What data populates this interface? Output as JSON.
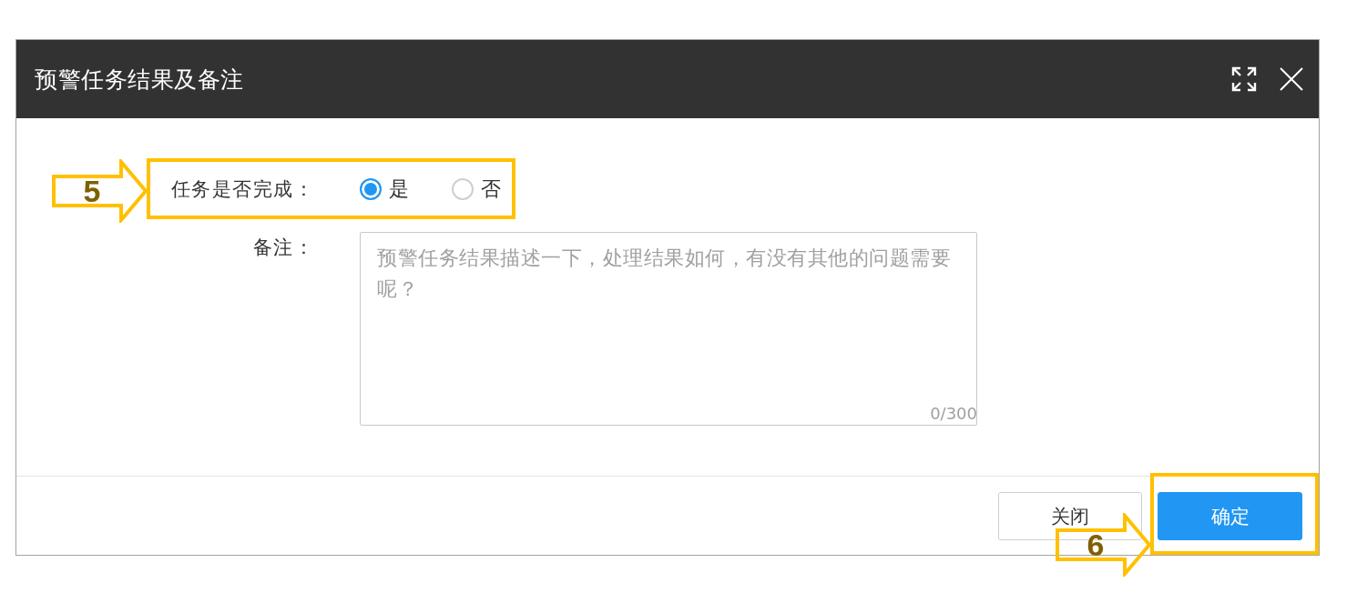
{
  "dialog": {
    "title": "预警任务结果及备注"
  },
  "form": {
    "completed": {
      "label": "任务是否完成：",
      "options": [
        {
          "label": "是",
          "selected": true
        },
        {
          "label": "否",
          "selected": false
        }
      ],
      "annotation": {
        "label": "5"
      }
    },
    "remark": {
      "label": "备注：",
      "placeholder": "预警任务结果描述一下，处理结果如何，有没有其他的问题需要呢？",
      "counter": "0/300"
    }
  },
  "footer": {
    "buttons": [
      {
        "label": "关闭",
        "kind": "secondary"
      },
      {
        "label": "确定",
        "kind": "primary",
        "annotation": {
          "label": "6"
        }
      }
    ]
  }
}
